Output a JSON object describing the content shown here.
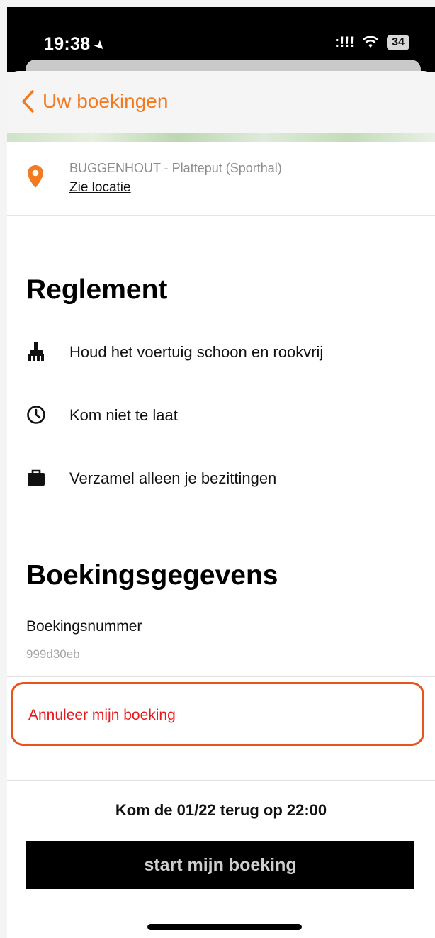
{
  "status_bar": {
    "time": "19:38",
    "signal": ":!!!",
    "wifi": "ᯤ",
    "battery": "34"
  },
  "nav": {
    "back_label": "Uw boekingen"
  },
  "location": {
    "address": "BUGGENHOUT - Platteput (Sporthal)",
    "link_label": "Zie locatie"
  },
  "rules": {
    "title": "Reglement",
    "items": [
      {
        "icon": "cleaning-brush-icon",
        "text": "Houd het voertuig schoon en rookvrij"
      },
      {
        "icon": "clock-icon",
        "text": "Kom niet te laat"
      },
      {
        "icon": "briefcase-icon",
        "text": "Verzamel alleen je bezittingen"
      }
    ]
  },
  "booking": {
    "title": "Boekingsgegevens",
    "number_label": "Boekingsnummer",
    "number_value": "999d30eb",
    "cancel_label": "Annuleer mijn boeking",
    "return_text": "Kom de 01/22 terug op 22:00",
    "start_button": "start mijn boeking"
  },
  "colors": {
    "accent": "#f47a20",
    "cancel_text": "#e8181c",
    "highlight_border": "#e8541a",
    "button_bg": "#000000"
  }
}
